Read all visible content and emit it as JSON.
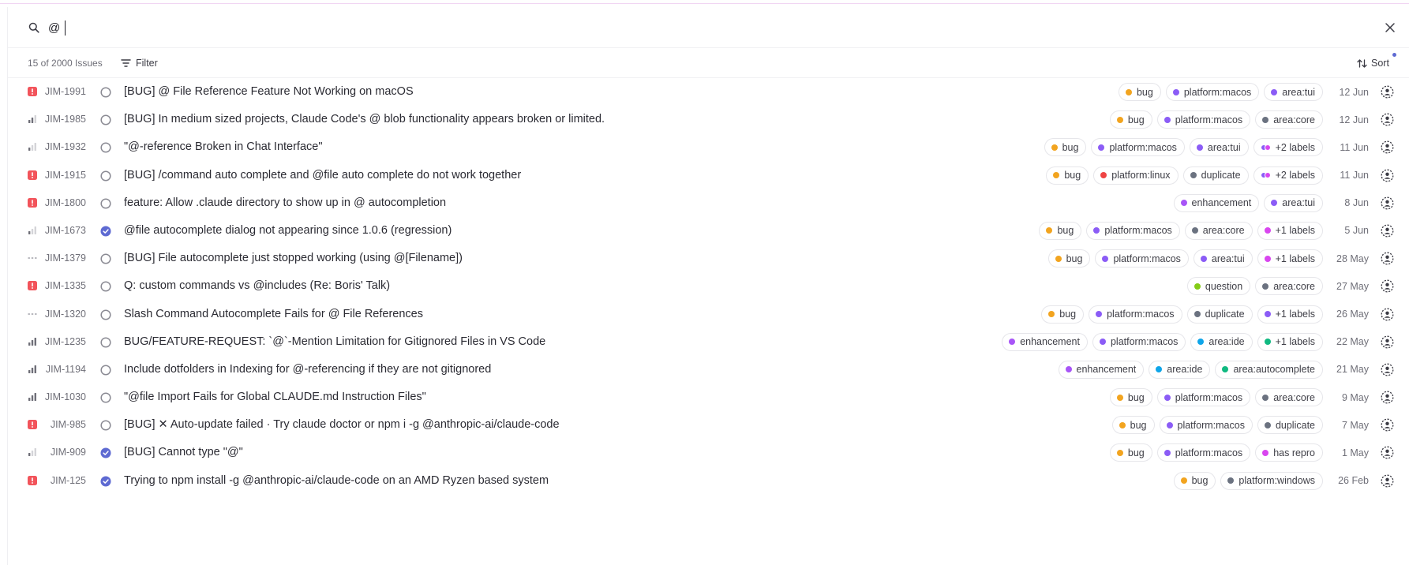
{
  "search": {
    "value": "@"
  },
  "toolbar": {
    "count": "15 of 2000 Issues",
    "filter_label": "Filter",
    "sort_label": "Sort"
  },
  "colors": {
    "bug": "#f2a41f",
    "platform": "#8b5cf6",
    "area": "#8b5cf6",
    "core": "#6b7280",
    "duplicate": "#6b7280",
    "linux": "#ef4444",
    "enhancement": "#a855f7",
    "question": "#84cc16",
    "ide": "#0ea5e9",
    "autocomplete": "#10b981",
    "repro": "#d946ef",
    "pink": "#d946ef",
    "accent": "#5e6ad2"
  },
  "issues": [
    {
      "id": "JIM-1991",
      "priority": "urgent-icon",
      "status": "todo",
      "title": "[BUG] @ File Reference Feature Not Working on macOS",
      "date": "12 Jun",
      "labels": [
        {
          "text": "bug",
          "color": "#f2a41f"
        },
        {
          "text": "platform:macos",
          "color": "#8b5cf6"
        },
        {
          "text": "area:tui",
          "color": "#8b5cf6"
        }
      ]
    },
    {
      "id": "JIM-1985",
      "priority": "medium-icon",
      "status": "todo",
      "title": "[BUG] In medium sized projects, Claude Code's @ blob functionality appears broken or limited.",
      "date": "12 Jun",
      "labels": [
        {
          "text": "bug",
          "color": "#f2a41f"
        },
        {
          "text": "platform:macos",
          "color": "#8b5cf6"
        },
        {
          "text": "area:core",
          "color": "#6b7280"
        }
      ]
    },
    {
      "id": "JIM-1932",
      "priority": "low-icon",
      "status": "todo",
      "title": "\"@-reference Broken in Chat Interface\"",
      "date": "11 Jun",
      "labels": [
        {
          "text": "bug",
          "color": "#f2a41f"
        },
        {
          "text": "platform:macos",
          "color": "#8b5cf6"
        },
        {
          "text": "area:tui",
          "color": "#8b5cf6"
        },
        {
          "text": "+2 labels",
          "color": "#d946ef",
          "color2": "#8b5cf6",
          "multi": true
        }
      ]
    },
    {
      "id": "JIM-1915",
      "priority": "urgent-icon",
      "status": "todo",
      "title": "[BUG] /command auto complete and @file auto complete do not work together",
      "date": "11 Jun",
      "labels": [
        {
          "text": "bug",
          "color": "#f2a41f"
        },
        {
          "text": "platform:linux",
          "color": "#ef4444"
        },
        {
          "text": "duplicate",
          "color": "#6b7280"
        },
        {
          "text": "+2 labels",
          "color": "#d946ef",
          "color2": "#8b5cf6",
          "multi": true
        }
      ]
    },
    {
      "id": "JIM-1800",
      "priority": "urgent-icon",
      "status": "todo",
      "title": "feature: Allow .claude directory to show up in @ autocompletion",
      "date": "8 Jun",
      "labels": [
        {
          "text": "enhancement",
          "color": "#a855f7"
        },
        {
          "text": "area:tui",
          "color": "#8b5cf6"
        }
      ]
    },
    {
      "id": "JIM-1673",
      "priority": "low-icon",
      "status": "done",
      "title": "@file autocomplete dialog not appearing since 1.0.6 (regression)",
      "date": "5 Jun",
      "labels": [
        {
          "text": "bug",
          "color": "#f2a41f"
        },
        {
          "text": "platform:macos",
          "color": "#8b5cf6"
        },
        {
          "text": "area:core",
          "color": "#6b7280"
        },
        {
          "text": "+1 labels",
          "color": "#d946ef"
        }
      ]
    },
    {
      "id": "JIM-1379",
      "priority": "none-icon",
      "status": "todo",
      "title": "[BUG] File autocomplete just stopped working (using @[Filename])",
      "date": "28 May",
      "labels": [
        {
          "text": "bug",
          "color": "#f2a41f"
        },
        {
          "text": "platform:macos",
          "color": "#8b5cf6"
        },
        {
          "text": "area:tui",
          "color": "#8b5cf6"
        },
        {
          "text": "+1 labels",
          "color": "#d946ef"
        }
      ]
    },
    {
      "id": "JIM-1335",
      "priority": "urgent-icon",
      "status": "todo",
      "title": "Q: custom commands vs @includes (Re: Boris' Talk)",
      "date": "27 May",
      "labels": [
        {
          "text": "question",
          "color": "#84cc16"
        },
        {
          "text": "area:core",
          "color": "#6b7280"
        }
      ]
    },
    {
      "id": "JIM-1320",
      "priority": "none-icon",
      "status": "todo",
      "title": "Slash Command Autocomplete Fails for @ File References",
      "date": "26 May",
      "labels": [
        {
          "text": "bug",
          "color": "#f2a41f"
        },
        {
          "text": "platform:macos",
          "color": "#8b5cf6"
        },
        {
          "text": "duplicate",
          "color": "#6b7280"
        },
        {
          "text": "+1 labels",
          "color": "#8b5cf6"
        }
      ]
    },
    {
      "id": "JIM-1235",
      "priority": "high-icon",
      "status": "todo",
      "title": "BUG/FEATURE-REQUEST: `@`-Mention Limitation for Gitignored Files in VS Code",
      "date": "22 May",
      "labels": [
        {
          "text": "enhancement",
          "color": "#a855f7"
        },
        {
          "text": "platform:macos",
          "color": "#8b5cf6"
        },
        {
          "text": "area:ide",
          "color": "#0ea5e9"
        },
        {
          "text": "+1 labels",
          "color": "#10b981"
        }
      ]
    },
    {
      "id": "JIM-1194",
      "priority": "high-icon",
      "status": "todo",
      "title": "Include dotfolders in Indexing for @-referencing if they are not gitignored",
      "date": "21 May",
      "labels": [
        {
          "text": "enhancement",
          "color": "#a855f7"
        },
        {
          "text": "area:ide",
          "color": "#0ea5e9"
        },
        {
          "text": "area:autocomplete",
          "color": "#10b981"
        }
      ]
    },
    {
      "id": "JIM-1030",
      "priority": "high-icon",
      "status": "todo",
      "title": "\"@file Import Fails for Global CLAUDE.md Instruction Files\"",
      "date": "9 May",
      "labels": [
        {
          "text": "bug",
          "color": "#f2a41f"
        },
        {
          "text": "platform:macos",
          "color": "#8b5cf6"
        },
        {
          "text": "area:core",
          "color": "#6b7280"
        }
      ]
    },
    {
      "id": "JIM-985",
      "priority": "urgent-icon",
      "status": "todo",
      "title": "[BUG] ✕ Auto-update failed · Try claude doctor or npm i -g @anthropic-ai/claude-code",
      "date": "7 May",
      "labels": [
        {
          "text": "bug",
          "color": "#f2a41f"
        },
        {
          "text": "platform:macos",
          "color": "#8b5cf6"
        },
        {
          "text": "duplicate",
          "color": "#6b7280"
        }
      ]
    },
    {
      "id": "JIM-909",
      "priority": "low-icon",
      "status": "done",
      "title": "[BUG] Cannot type \"@\"",
      "date": "1 May",
      "labels": [
        {
          "text": "bug",
          "color": "#f2a41f"
        },
        {
          "text": "platform:macos",
          "color": "#8b5cf6"
        },
        {
          "text": "has repro",
          "color": "#d946ef"
        }
      ]
    },
    {
      "id": "JIM-125",
      "priority": "urgent-icon",
      "status": "done",
      "title": "Trying to npm install -g @anthropic-ai/claude-code on an AMD Ryzen based system",
      "date": "26 Feb",
      "labels": [
        {
          "text": "bug",
          "color": "#f2a41f"
        },
        {
          "text": "platform:windows",
          "color": "#6b7280"
        }
      ]
    }
  ]
}
